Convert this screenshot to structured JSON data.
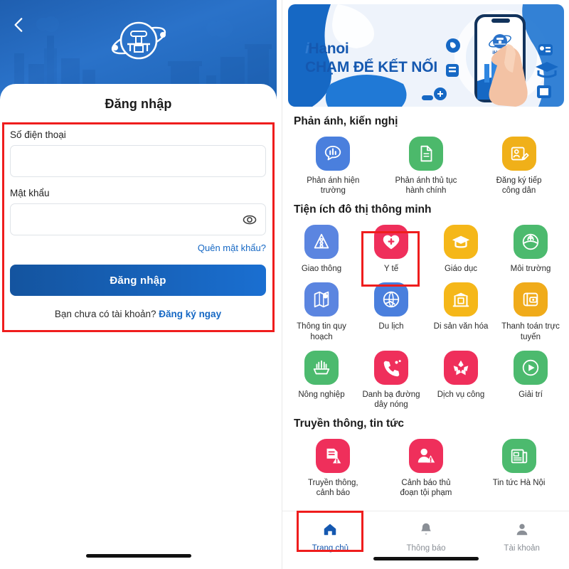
{
  "login": {
    "back_icon": "chevron-left-icon",
    "logo_icon": "ihanoi-logo-icon",
    "title": "Đăng nhập",
    "phone_label": "Số điện thoại",
    "phone_value": "",
    "phone_placeholder": "",
    "password_label": "Mật khẩu",
    "password_value": "",
    "password_placeholder": "",
    "eye_icon": "eye-icon",
    "forgot_label": "Quên mật khẩu?",
    "submit_label": "Đăng nhập",
    "signup_prompt": "Bạn chưa có tài khoản? ",
    "signup_link": "Đăng ký ngay"
  },
  "banner": {
    "brand_i": "i",
    "brand_name": "Hanoi",
    "tagline": "CHẠM ĐỂ KẾT NỐI"
  },
  "sections": [
    {
      "title": "Phản ánh, kiến nghị",
      "columns": 3,
      "items": [
        {
          "label": "Phản ánh hiện trường",
          "color": "#4a7fdd",
          "icon": "megaphone-chat-icon"
        },
        {
          "label": "Phản ánh thủ tục hành chính",
          "color": "#4cb96b",
          "icon": "document-stack-icon"
        },
        {
          "label": "Đăng ký tiếp công dân",
          "color": "#f0b019",
          "icon": "register-card-icon"
        }
      ]
    },
    {
      "title": "Tiện ích đô thị thông minh",
      "columns": 4,
      "items": [
        {
          "label": "Giao thông",
          "color": "#5b85e0",
          "icon": "traffic-light-icon"
        },
        {
          "label": "Y tế",
          "color": "#ef2f5b",
          "icon": "heart-medical-icon"
        },
        {
          "label": "Giáo dục",
          "color": "#f5b719",
          "icon": "graduation-cap-icon"
        },
        {
          "label": "Môi trường",
          "color": "#4cba6e",
          "icon": "environment-globe-icon"
        },
        {
          "label": "Thông tin quy hoạch",
          "color": "#5b85e0",
          "icon": "map-pin-icon"
        },
        {
          "label": "Du lịch",
          "color": "#4a7fdd",
          "icon": "travel-globe-icon"
        },
        {
          "label": "Di sản văn hóa",
          "color": "#f5b719",
          "icon": "heritage-gate-icon"
        },
        {
          "label": "Thanh toán trực tuyến",
          "color": "#f0ab1a",
          "icon": "wallet-card-icon"
        },
        {
          "label": "Nông nghiệp",
          "color": "#4cba6e",
          "icon": "agriculture-plant-icon"
        },
        {
          "label": "Danh bạ đường dây nóng",
          "color": "#ef2f5b",
          "icon": "hotline-phone-icon"
        },
        {
          "label": "Dịch vụ công",
          "color": "#ef2f5b",
          "icon": "public-service-icon"
        },
        {
          "label": "Giải trí",
          "color": "#4cba6e",
          "icon": "play-entertainment-icon"
        }
      ]
    },
    {
      "title": "Truyền thông, tin tức",
      "columns": 3,
      "items": [
        {
          "label": "Truyền thông, cảnh báo",
          "color": "#ef2f5b",
          "icon": "alert-document-icon"
        },
        {
          "label": "Cảnh báo thủ đoạn tội phạm",
          "color": "#ef2f5b",
          "icon": "crime-alert-person-icon"
        },
        {
          "label": "Tin tức Hà Nội",
          "color": "#4cba6e",
          "icon": "newspaper-icon"
        }
      ]
    }
  ],
  "bottom_nav": [
    {
      "label": "Trang chủ",
      "icon": "home-icon",
      "active": true
    },
    {
      "label": "Thông báo",
      "icon": "bell-icon",
      "active": false
    },
    {
      "label": "Tài khoản",
      "icon": "person-icon",
      "active": false
    }
  ],
  "highlight_color": "#ef1d1d"
}
